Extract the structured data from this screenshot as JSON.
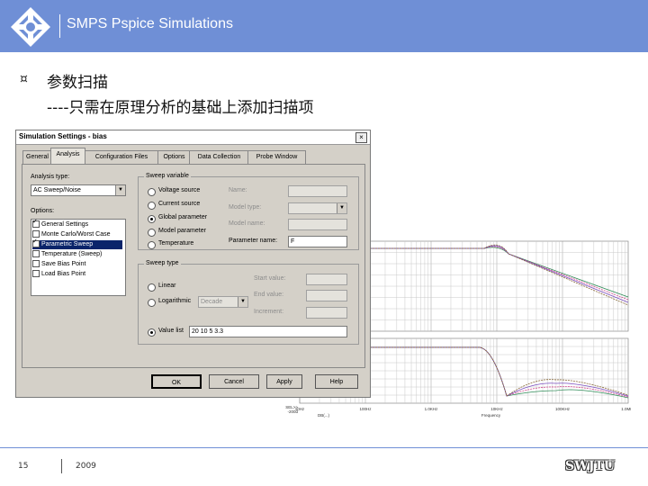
{
  "header": {
    "title": "SMPS Pspice Simulations",
    "bg_color": "#6f8fd6"
  },
  "slide": {
    "bullet_icon": "¤",
    "line1": "参数扫描",
    "line2": "----只需在原理分析的基础上添加扫描项"
  },
  "dialog": {
    "title": "Simulation Settings - bias",
    "close_label": "×",
    "tabs": [
      "General",
      "Analysis",
      "Configuration Files",
      "Options",
      "Data Collection",
      "Probe Window"
    ],
    "analysis_type_label": "Analysis type:",
    "analysis_type_value": "AC Sweep/Noise",
    "options_label": "Options:",
    "options": [
      {
        "label": "General Settings",
        "checked": true,
        "selected": false
      },
      {
        "label": "Monte Carlo/Worst Case",
        "checked": false,
        "selected": false
      },
      {
        "label": "Parametric Sweep",
        "checked": true,
        "selected": true
      },
      {
        "label": "Temperature (Sweep)",
        "checked": false,
        "selected": false
      },
      {
        "label": "Save Bias Point",
        "checked": false,
        "selected": false
      },
      {
        "label": "Load Bias Point",
        "checked": false,
        "selected": false
      }
    ],
    "sweep_variable_label": "Sweep variable",
    "sweep_variables": [
      "Voltage source",
      "Current source",
      "Global parameter",
      "Model parameter",
      "Temperature"
    ],
    "selected_sweep_variable": 2,
    "name_label": "Name:",
    "model_type_label": "Model type:",
    "model_name_label": "Model name:",
    "parameter_name_label": "Parameter name:",
    "parameter_name_value": "F",
    "sweep_type_label": "Sweep type",
    "sweep_types": [
      "Linear",
      "Logarithmic",
      "Value list"
    ],
    "log_scale_value": "Decade",
    "start_value_label": "Start value:",
    "end_value_label": "End value:",
    "increment_label": "Increment:",
    "value_list": "20 10 5 3.3",
    "buttons": {
      "ok": "OK",
      "cancel": "Cancel",
      "apply": "Apply",
      "help": "Help"
    }
  },
  "plot": {
    "x_ticks": [
      "10Hz",
      "100Hz",
      "1.0KHz",
      "10KHz",
      "100KHz",
      "1.0MHz"
    ],
    "x_label": "Frequency",
    "legend_label": "DB(...)",
    "top_y_ticks": [
      "",
      "",
      "",
      "",
      "",
      ""
    ],
    "bottom_y_labels": [
      "SEL>>",
      "-200d"
    ],
    "series_colors": [
      "#2e8b57",
      "#d14b8f",
      "#7b4fbf",
      "#8a6a3a"
    ]
  },
  "footer": {
    "page_number": "15",
    "year": "2009",
    "brand": "SWJTU"
  }
}
